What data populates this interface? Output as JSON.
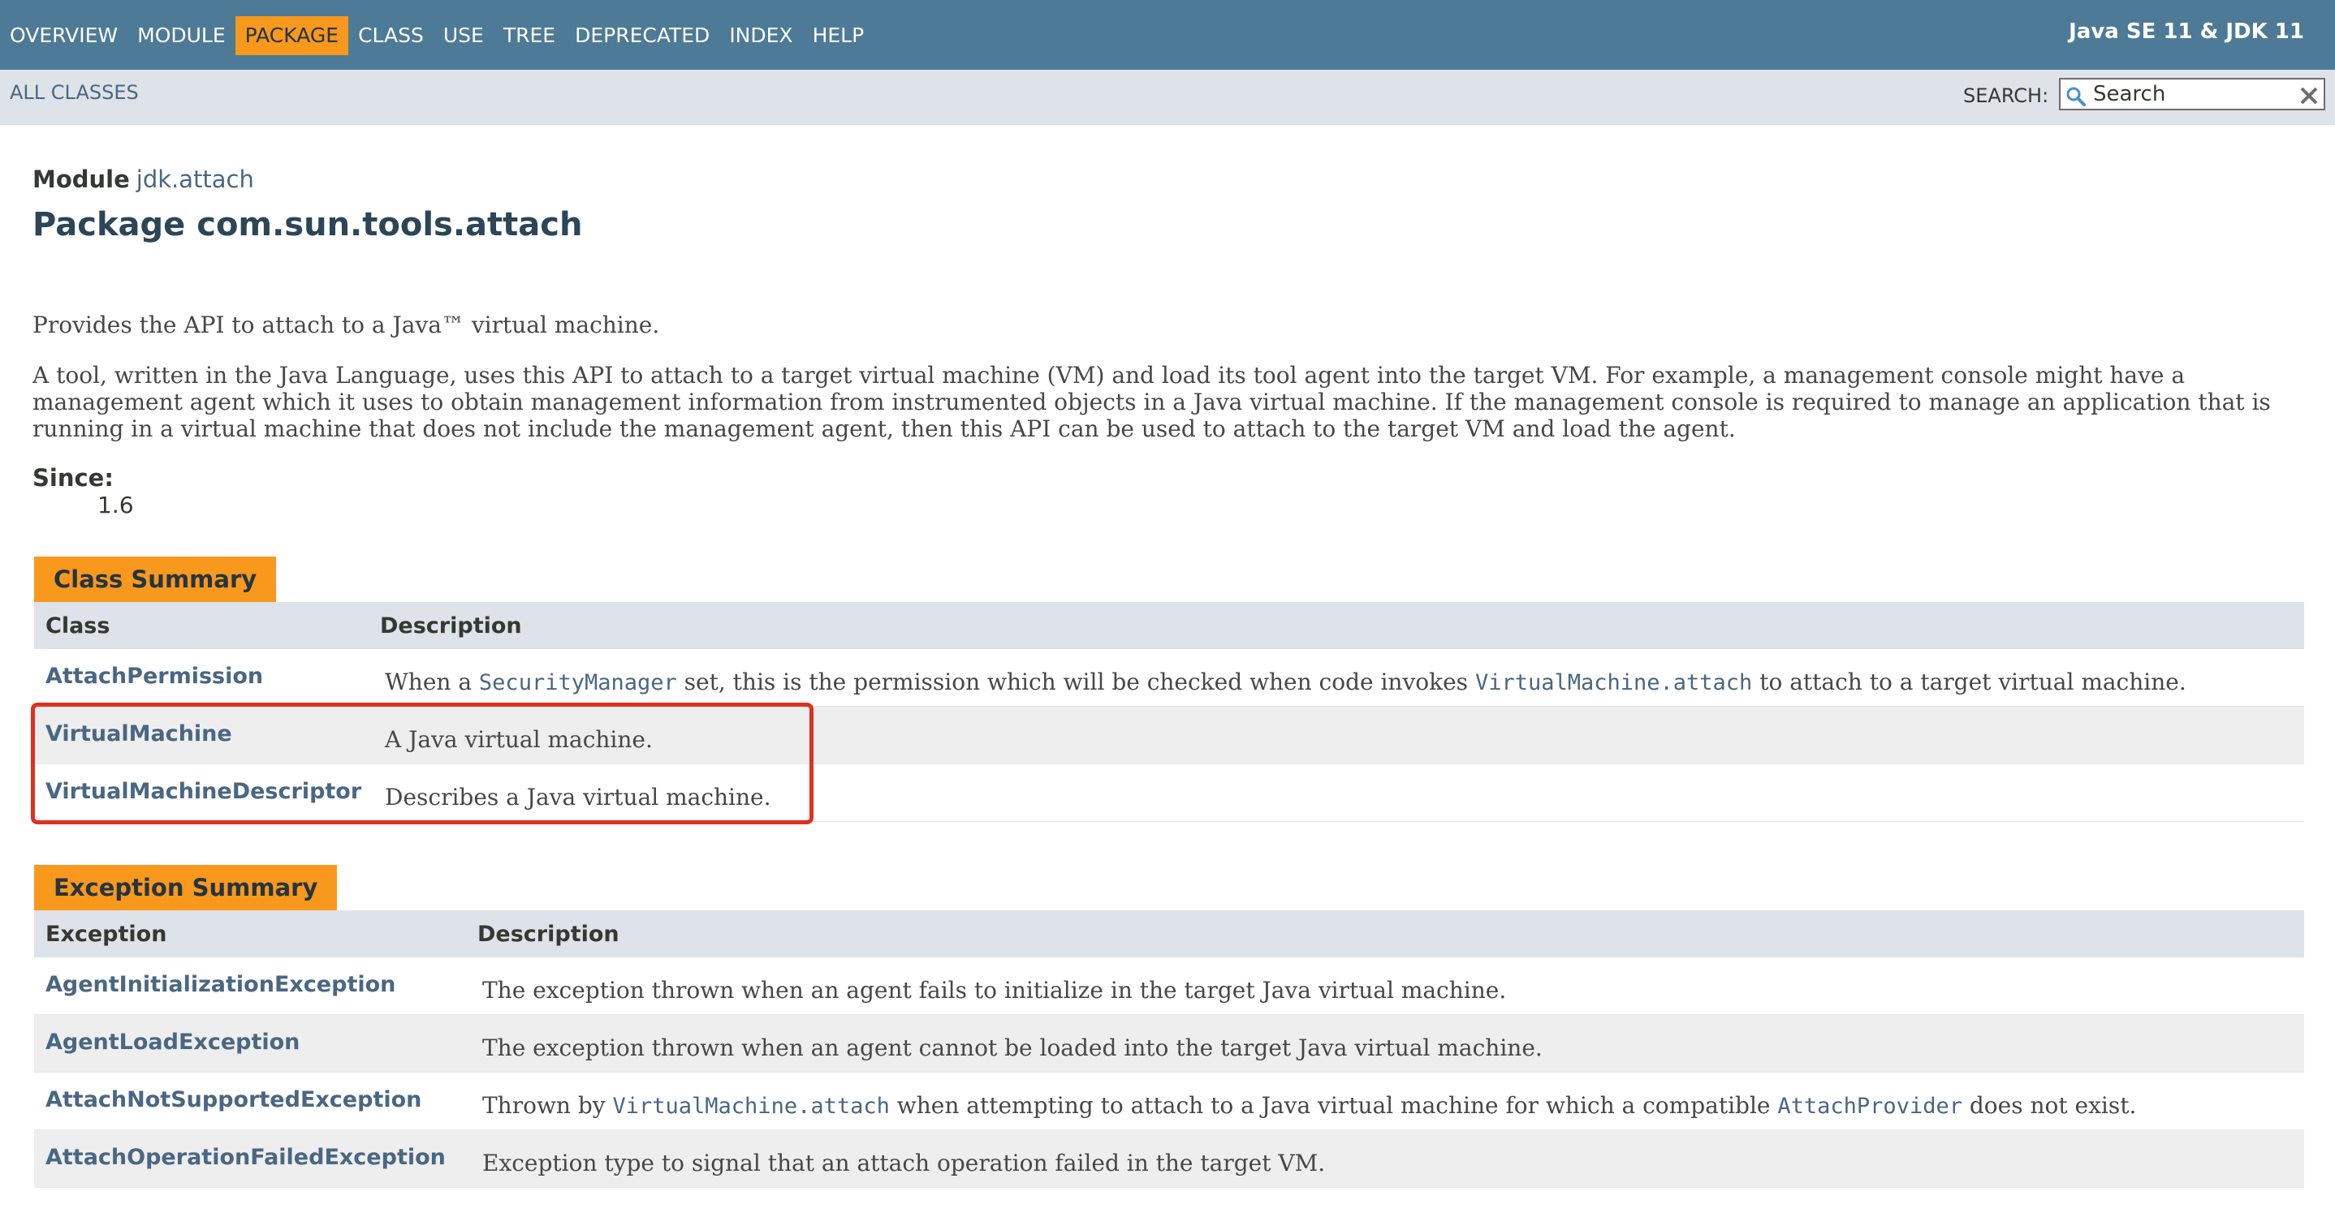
{
  "nav": {
    "items": [
      {
        "label": "OVERVIEW",
        "active": false
      },
      {
        "label": "MODULE",
        "active": false
      },
      {
        "label": "PACKAGE",
        "active": true
      },
      {
        "label": "CLASS",
        "active": false
      },
      {
        "label": "USE",
        "active": false
      },
      {
        "label": "TREE",
        "active": false
      },
      {
        "label": "DEPRECATED",
        "active": false
      },
      {
        "label": "INDEX",
        "active": false
      },
      {
        "label": "HELP",
        "active": false
      }
    ],
    "about": "Java SE 11 & JDK 11"
  },
  "subnav": {
    "all_classes": "ALL CLASSES",
    "search_label": "SEARCH:",
    "search_placeholder": "Search"
  },
  "header": {
    "module_label": "Module",
    "module_name": "jdk.attach",
    "package_title": "Package com.sun.tools.attach"
  },
  "description": {
    "intro": "Provides the API to attach to a Java™ virtual machine.",
    "paragraph": "A tool, written in the Java Language, uses this API to attach to a target virtual machine (VM) and load its tool agent into the target VM. For example, a management console might have a management agent which it uses to obtain management information from instrumented objects in a Java virtual machine. If the management console is required to manage an application that is running in a virtual machine that does not include the management agent, then this API can be used to attach to the target VM and load the agent.",
    "since_label": "Since:",
    "since_value": "1.6"
  },
  "class_summary": {
    "caption": "Class Summary",
    "col1": "Class",
    "col2": "Description",
    "rows": [
      {
        "name": "AttachPermission",
        "desc_a": "When a ",
        "code_a": "SecurityManager",
        "desc_b": " set, this is the permission which will be checked when code invokes ",
        "code_b": "VirtualMachine.attach",
        "desc_c": " to attach to a target virtual machine."
      },
      {
        "name": "VirtualMachine",
        "desc": "A Java virtual machine."
      },
      {
        "name": "VirtualMachineDescriptor",
        "desc": "Describes a Java virtual machine."
      }
    ]
  },
  "exception_summary": {
    "caption": "Exception Summary",
    "col1": "Exception",
    "col2": "Description",
    "rows": [
      {
        "name": "AgentInitializationException",
        "desc": "The exception thrown when an agent fails to initialize in the target Java virtual machine."
      },
      {
        "name": "AgentLoadException",
        "desc": "The exception thrown when an agent cannot be loaded into the target Java virtual machine."
      },
      {
        "name": "AttachNotSupportedException",
        "desc_a": "Thrown by ",
        "code_a": "VirtualMachine.attach",
        "desc_b": " when attempting to attach to a Java virtual machine for which a compatible ",
        "code_b": "AttachProvider",
        "desc_c": " does not exist."
      },
      {
        "name": "AttachOperationFailedException",
        "desc": "Exception type to signal that an attach operation failed in the target VM."
      }
    ]
  },
  "colors": {
    "nav_bg": "#4D7A97",
    "accent": "#F8981D",
    "link": "#4A6782",
    "highlight": "#E0301E"
  }
}
